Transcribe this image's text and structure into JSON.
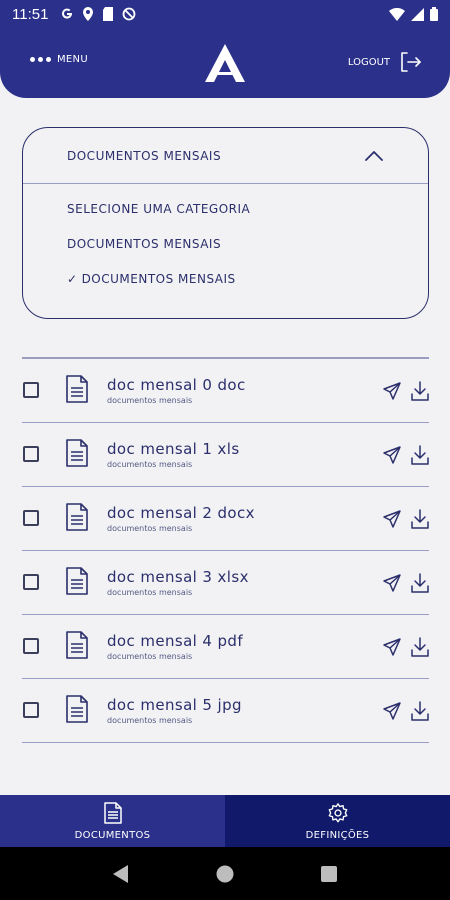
{
  "status_bar": {
    "time": "11:51",
    "icons": [
      "google-icon",
      "location-icon",
      "sd-card-icon",
      "no-data-icon"
    ],
    "right_icons": [
      "wifi-icon",
      "signal-icon",
      "battery-icon"
    ]
  },
  "header": {
    "menu_label": "MENU",
    "logout_label": "LOGOUT",
    "logo": "app-logo-a"
  },
  "category_dropdown": {
    "selected": "DOCUMENTOS MENSAIS",
    "options": [
      {
        "label": "SELECIONE UMA CATEGORIA",
        "checked": false
      },
      {
        "label": "DOCUMENTOS MENSAIS",
        "checked": false
      },
      {
        "label": "DOCUMENTOS MENSAIS",
        "checked": true
      }
    ],
    "check_mark": "✓"
  },
  "documents": [
    {
      "title": "doc mensal 0 doc",
      "category": "documentos mensais"
    },
    {
      "title": "doc mensal 1 xls",
      "category": "documentos mensais"
    },
    {
      "title": "doc mensal 2 docx",
      "category": "documentos mensais"
    },
    {
      "title": "doc mensal 3 xlsx",
      "category": "documentos mensais"
    },
    {
      "title": "doc mensal 4 pdf",
      "category": "documentos mensais"
    },
    {
      "title": "doc mensal 5 jpg",
      "category": "documentos mensais"
    }
  ],
  "bottom_nav": {
    "documents_label": "DOCUMENTOS",
    "settings_label": "DEFINIÇÕES",
    "active": "documentos"
  },
  "colors": {
    "primary": "#2b318a",
    "primary_dark": "#11196a",
    "text": "#2b2f6b",
    "background": "#f2f2f4"
  }
}
